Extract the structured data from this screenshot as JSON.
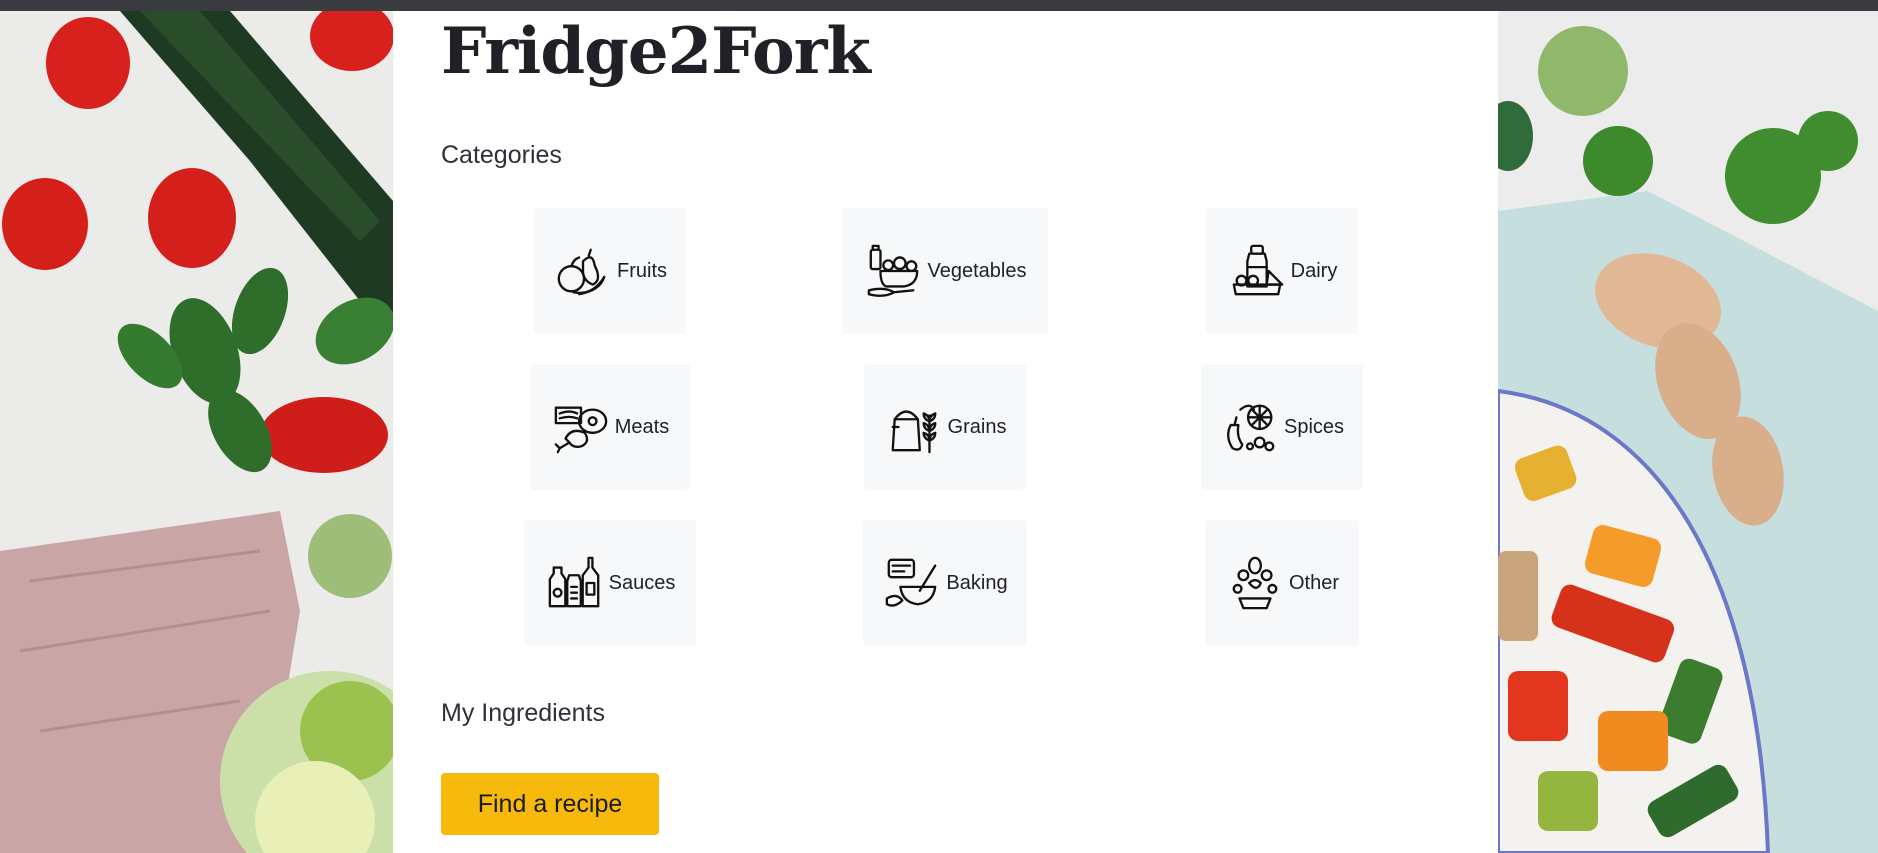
{
  "app": {
    "title": "Fridge2Fork",
    "accent_color": "#f7b90c",
    "card_bg": "#f7f8fa"
  },
  "sections": {
    "categories_heading": "Categories",
    "ingredients_heading": "My Ingredients"
  },
  "categories": [
    {
      "label": "Fruits",
      "icon": "fruits-icon"
    },
    {
      "label": "Vegetables",
      "icon": "vegetables-icon"
    },
    {
      "label": "Dairy",
      "icon": "dairy-icon"
    },
    {
      "label": "Meats",
      "icon": "meats-icon"
    },
    {
      "label": "Grains",
      "icon": "grains-icon"
    },
    {
      "label": "Spices",
      "icon": "spices-icon"
    },
    {
      "label": "Sauces",
      "icon": "sauces-icon"
    },
    {
      "label": "Baking",
      "icon": "baking-icon"
    },
    {
      "label": "Other",
      "icon": "other-icon"
    }
  ],
  "actions": {
    "find_recipe_label": "Find a recipe"
  }
}
